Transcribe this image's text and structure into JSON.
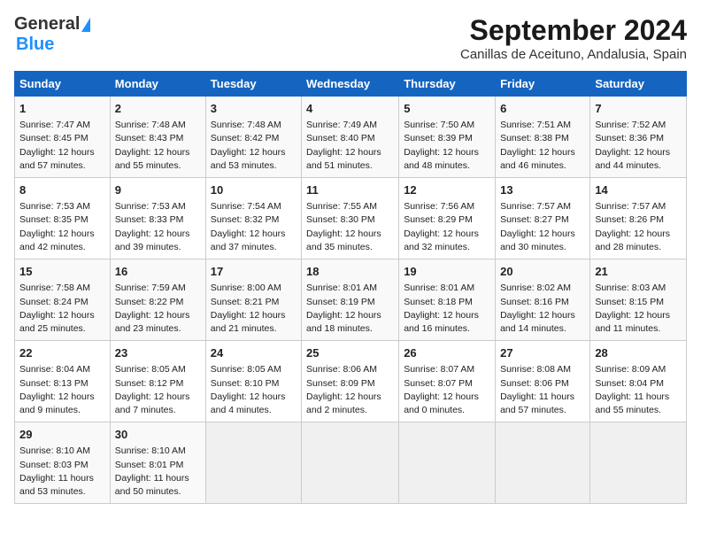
{
  "header": {
    "logo_general": "General",
    "logo_blue": "Blue",
    "title": "September 2024",
    "subtitle": "Canillas de Aceituno, Andalusia, Spain"
  },
  "calendar": {
    "days_of_week": [
      "Sunday",
      "Monday",
      "Tuesday",
      "Wednesday",
      "Thursday",
      "Friday",
      "Saturday"
    ],
    "weeks": [
      [
        {
          "day": "",
          "empty": true
        },
        {
          "day": "",
          "empty": true
        },
        {
          "day": "",
          "empty": true
        },
        {
          "day": "",
          "empty": true
        },
        {
          "day": "",
          "empty": true
        },
        {
          "day": "",
          "empty": true
        },
        {
          "day": "",
          "empty": true
        }
      ],
      [
        {
          "day": "1",
          "content": "Sunrise: 7:47 AM\nSunset: 8:45 PM\nDaylight: 12 hours\nand 57 minutes."
        },
        {
          "day": "2",
          "content": "Sunrise: 7:48 AM\nSunset: 8:43 PM\nDaylight: 12 hours\nand 55 minutes."
        },
        {
          "day": "3",
          "content": "Sunrise: 7:48 AM\nSunset: 8:42 PM\nDaylight: 12 hours\nand 53 minutes."
        },
        {
          "day": "4",
          "content": "Sunrise: 7:49 AM\nSunset: 8:40 PM\nDaylight: 12 hours\nand 51 minutes."
        },
        {
          "day": "5",
          "content": "Sunrise: 7:50 AM\nSunset: 8:39 PM\nDaylight: 12 hours\nand 48 minutes."
        },
        {
          "day": "6",
          "content": "Sunrise: 7:51 AM\nSunset: 8:38 PM\nDaylight: 12 hours\nand 46 minutes."
        },
        {
          "day": "7",
          "content": "Sunrise: 7:52 AM\nSunset: 8:36 PM\nDaylight: 12 hours\nand 44 minutes."
        }
      ],
      [
        {
          "day": "8",
          "content": "Sunrise: 7:53 AM\nSunset: 8:35 PM\nDaylight: 12 hours\nand 42 minutes."
        },
        {
          "day": "9",
          "content": "Sunrise: 7:53 AM\nSunset: 8:33 PM\nDaylight: 12 hours\nand 39 minutes."
        },
        {
          "day": "10",
          "content": "Sunrise: 7:54 AM\nSunset: 8:32 PM\nDaylight: 12 hours\nand 37 minutes."
        },
        {
          "day": "11",
          "content": "Sunrise: 7:55 AM\nSunset: 8:30 PM\nDaylight: 12 hours\nand 35 minutes."
        },
        {
          "day": "12",
          "content": "Sunrise: 7:56 AM\nSunset: 8:29 PM\nDaylight: 12 hours\nand 32 minutes."
        },
        {
          "day": "13",
          "content": "Sunrise: 7:57 AM\nSunset: 8:27 PM\nDaylight: 12 hours\nand 30 minutes."
        },
        {
          "day": "14",
          "content": "Sunrise: 7:57 AM\nSunset: 8:26 PM\nDaylight: 12 hours\nand 28 minutes."
        }
      ],
      [
        {
          "day": "15",
          "content": "Sunrise: 7:58 AM\nSunset: 8:24 PM\nDaylight: 12 hours\nand 25 minutes."
        },
        {
          "day": "16",
          "content": "Sunrise: 7:59 AM\nSunset: 8:22 PM\nDaylight: 12 hours\nand 23 minutes."
        },
        {
          "day": "17",
          "content": "Sunrise: 8:00 AM\nSunset: 8:21 PM\nDaylight: 12 hours\nand 21 minutes."
        },
        {
          "day": "18",
          "content": "Sunrise: 8:01 AM\nSunset: 8:19 PM\nDaylight: 12 hours\nand 18 minutes."
        },
        {
          "day": "19",
          "content": "Sunrise: 8:01 AM\nSunset: 8:18 PM\nDaylight: 12 hours\nand 16 minutes."
        },
        {
          "day": "20",
          "content": "Sunrise: 8:02 AM\nSunset: 8:16 PM\nDaylight: 12 hours\nand 14 minutes."
        },
        {
          "day": "21",
          "content": "Sunrise: 8:03 AM\nSunset: 8:15 PM\nDaylight: 12 hours\nand 11 minutes."
        }
      ],
      [
        {
          "day": "22",
          "content": "Sunrise: 8:04 AM\nSunset: 8:13 PM\nDaylight: 12 hours\nand 9 minutes."
        },
        {
          "day": "23",
          "content": "Sunrise: 8:05 AM\nSunset: 8:12 PM\nDaylight: 12 hours\nand 7 minutes."
        },
        {
          "day": "24",
          "content": "Sunrise: 8:05 AM\nSunset: 8:10 PM\nDaylight: 12 hours\nand 4 minutes."
        },
        {
          "day": "25",
          "content": "Sunrise: 8:06 AM\nSunset: 8:09 PM\nDaylight: 12 hours\nand 2 minutes."
        },
        {
          "day": "26",
          "content": "Sunrise: 8:07 AM\nSunset: 8:07 PM\nDaylight: 12 hours\nand 0 minutes."
        },
        {
          "day": "27",
          "content": "Sunrise: 8:08 AM\nSunset: 8:06 PM\nDaylight: 11 hours\nand 57 minutes."
        },
        {
          "day": "28",
          "content": "Sunrise: 8:09 AM\nSunset: 8:04 PM\nDaylight: 11 hours\nand 55 minutes."
        }
      ],
      [
        {
          "day": "29",
          "content": "Sunrise: 8:10 AM\nSunset: 8:03 PM\nDaylight: 11 hours\nand 53 minutes."
        },
        {
          "day": "30",
          "content": "Sunrise: 8:10 AM\nSunset: 8:01 PM\nDaylight: 11 hours\nand 50 minutes."
        },
        {
          "day": "",
          "empty": true
        },
        {
          "day": "",
          "empty": true
        },
        {
          "day": "",
          "empty": true
        },
        {
          "day": "",
          "empty": true
        },
        {
          "day": "",
          "empty": true
        }
      ]
    ]
  }
}
